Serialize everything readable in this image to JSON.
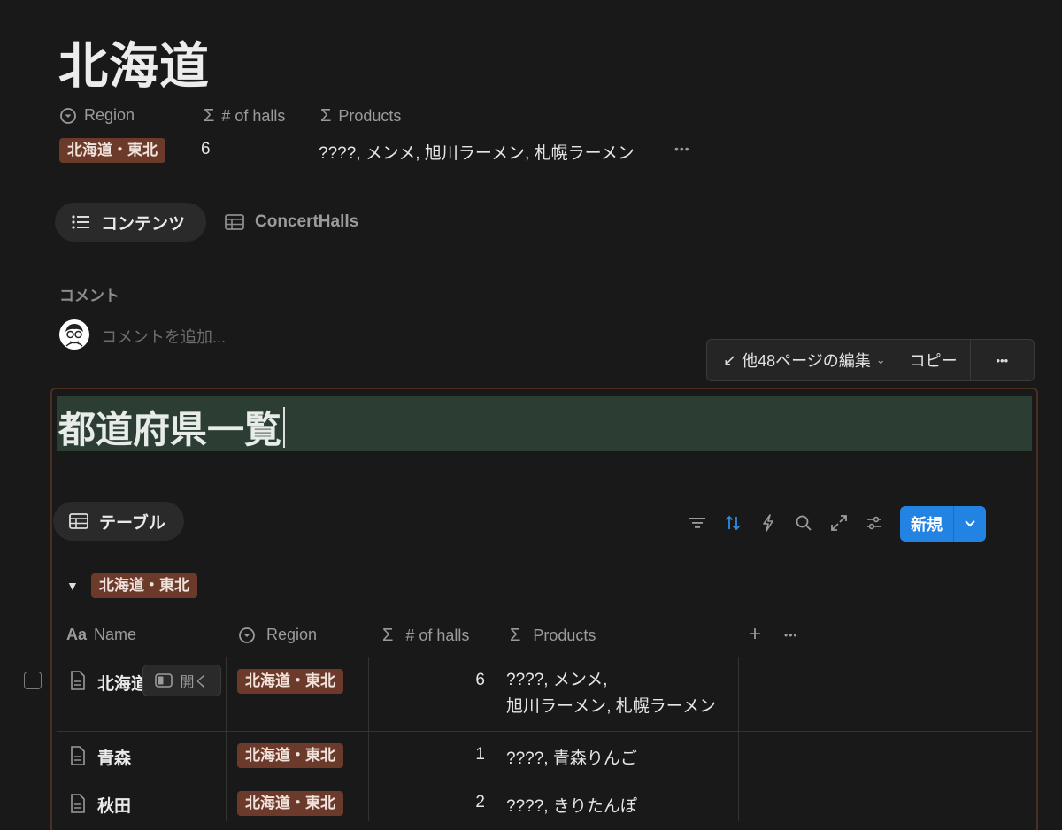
{
  "page": {
    "title": "北海道",
    "properties": {
      "region_label": "Region",
      "halls_label": "# of halls",
      "products_label": "Products",
      "region_value": "北海道・東北",
      "halls_value": "6",
      "products_value": "????, メンメ, 旭川ラーメン, 札幌ラーメン",
      "more": "•••"
    },
    "tabs": [
      {
        "label": "コンテンツ",
        "icon": "list-icon",
        "active": true
      },
      {
        "label": "ConcertHalls",
        "icon": "table-icon",
        "active": false
      }
    ],
    "comments": {
      "heading": "コメント",
      "placeholder": "コメントを追加..."
    }
  },
  "sync_bar": {
    "edit_label": "他48ページの編集",
    "copy_label": "コピー",
    "more": "•••"
  },
  "database": {
    "title": "都道府県一覧",
    "view_label": "テーブル",
    "new_label": "新規",
    "group_label": "北海道・東北",
    "columns": {
      "name": "Name",
      "region": "Region",
      "halls": "# of halls",
      "products": "Products"
    },
    "open_label": "開く",
    "rows": [
      {
        "name": "北海道",
        "region": "北海道・東北",
        "halls": "6",
        "products_line1": "????, メンメ,",
        "products_line2": "旭川ラーメン, 札幌ラーメン"
      },
      {
        "name": "青森",
        "region": "北海道・東北",
        "halls": "1",
        "products_line1": "????, 青森りんご",
        "products_line2": ""
      },
      {
        "name": "秋田",
        "region": "北海道・東北",
        "halls": "2",
        "products_line1": "????, きりたんぽ",
        "products_line2": ""
      }
    ]
  },
  "colors": {
    "background": "#191919",
    "tag_brown": "#6b3a2a",
    "accent_blue": "#2383e2",
    "title_highlight": "#2c3d33",
    "frame_border": "#4a2e20"
  }
}
